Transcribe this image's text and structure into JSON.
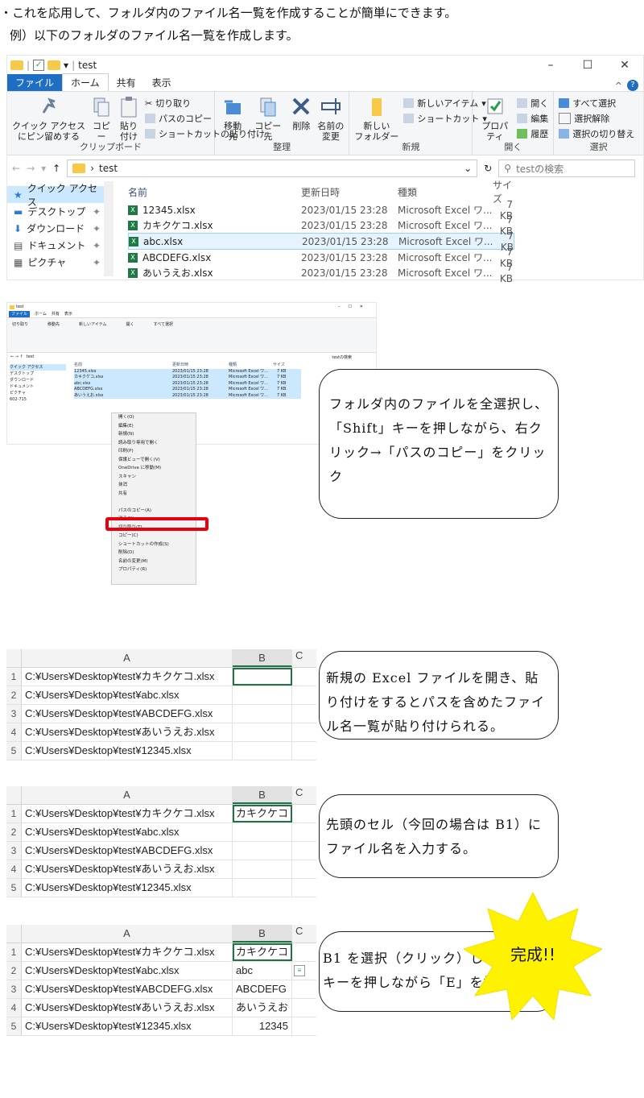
{
  "intro_line1": "・これを応用して、フォルダ内のファイル名一覧を作成することが簡単にできます。",
  "intro_line2": "例）以下のフォルダのファイル名一覧を作成します。",
  "explorer": {
    "title": "test",
    "tabs": [
      "ファイル",
      "ホーム",
      "共有",
      "表示"
    ],
    "groups": {
      "clipboard": {
        "name": "クリップボード",
        "pin": "クイック アクセス\nにピン留めする",
        "copy": "コピー",
        "paste": "貼り付け",
        "cut": "切り取り",
        "copy_path": "パスのコピー",
        "paste_shortcut": "ショートカットの貼り付け"
      },
      "organize": {
        "name": "整理",
        "move_to": "移動先",
        "copy_to": "コピー先",
        "delete": "削除",
        "rename": "名前の\n変更"
      },
      "new": {
        "name": "新規",
        "new_folder": "新しい\nフォルダー",
        "new_item": "新しいアイテム",
        "shortcut": "ショートカット"
      },
      "open": {
        "name": "開く",
        "properties": "プロパティ",
        "open": "開く",
        "edit": "編集",
        "history": "履歴"
      },
      "select": {
        "name": "選択",
        "select_all": "すべて選択",
        "select_none": "選択解除",
        "invert": "選択の切り替え"
      }
    },
    "address": "test",
    "search_placeholder": "testの検索",
    "nav": [
      "クイック アクセス",
      "デスクトップ",
      "ダウンロード",
      "ドキュメント",
      "ピクチャ"
    ],
    "columns": [
      "名前",
      "更新日時",
      "種類",
      "サイズ"
    ],
    "files": [
      {
        "name": "12345.xlsx",
        "date": "2023/01/15 23:28",
        "type": "Microsoft Excel ワ...",
        "size": "7 KB"
      },
      {
        "name": "カキクケコ.xlsx",
        "date": "2023/01/15 23:28",
        "type": "Microsoft Excel ワ...",
        "size": "7 KB"
      },
      {
        "name": "abc.xlsx",
        "date": "2023/01/15 23:28",
        "type": "Microsoft Excel ワ...",
        "size": "7 KB"
      },
      {
        "name": "ABCDEFG.xlsx",
        "date": "2023/01/15 23:28",
        "type": "Microsoft Excel ワ...",
        "size": "7 KB"
      },
      {
        "name": "あいうえお.xlsx",
        "date": "2023/01/15 23:28",
        "type": "Microsoft Excel ワ...",
        "size": "7 KB"
      }
    ]
  },
  "small_nav_extra": "602-715",
  "context_menu": [
    "開く(O)",
    "編集(E)",
    "新規(N)",
    "読み取り専用で開く",
    "印刷(P)",
    "保護ビューで開く(V)",
    "OneDrive に移動(M)",
    "スキャン",
    "抹消",
    "共有",
    "",
    "パスのコピー(A)",
    "送る(N)",
    "切り取り(T)",
    "コピー(C)",
    "ショートカットの作成(S)",
    "削除(D)",
    "名前の変更(M)",
    "プロパティ(R)"
  ],
  "callouts": {
    "c1": "フォルダ内のファイルを全選択し、「Shift」キーを押しながら、右クリック→「パスのコピー」をクリック",
    "c2": "新規の Excel ファイルを開き、貼り付けをするとパスを含めたファイル名一覧が貼り付けられる。",
    "c3": "先頭のセル（今回の場合は B1）にファイル名を入力する。",
    "c4": "B1 を選択（クリック）し、「Ctrl」キーを押しながら「E」を押す。"
  },
  "excel": {
    "col_a": "A",
    "col_b": "B",
    "col_c": "C",
    "paths": [
      "C:¥Users¥Desktop¥test¥カキクケコ.xlsx",
      "C:¥Users¥Desktop¥test¥abc.xlsx",
      "C:¥Users¥Desktop¥test¥ABCDEFG.xlsx",
      "C:¥Users¥Desktop¥test¥あいうえお.xlsx",
      "C:¥Users¥Desktop¥test¥12345.xlsx"
    ],
    "b_step2": [
      "カキクケコ"
    ],
    "b_step3": [
      "カキクケコ",
      "abc",
      "ABCDEFG",
      "あいうえお",
      "12345"
    ]
  },
  "done": "完成!!"
}
